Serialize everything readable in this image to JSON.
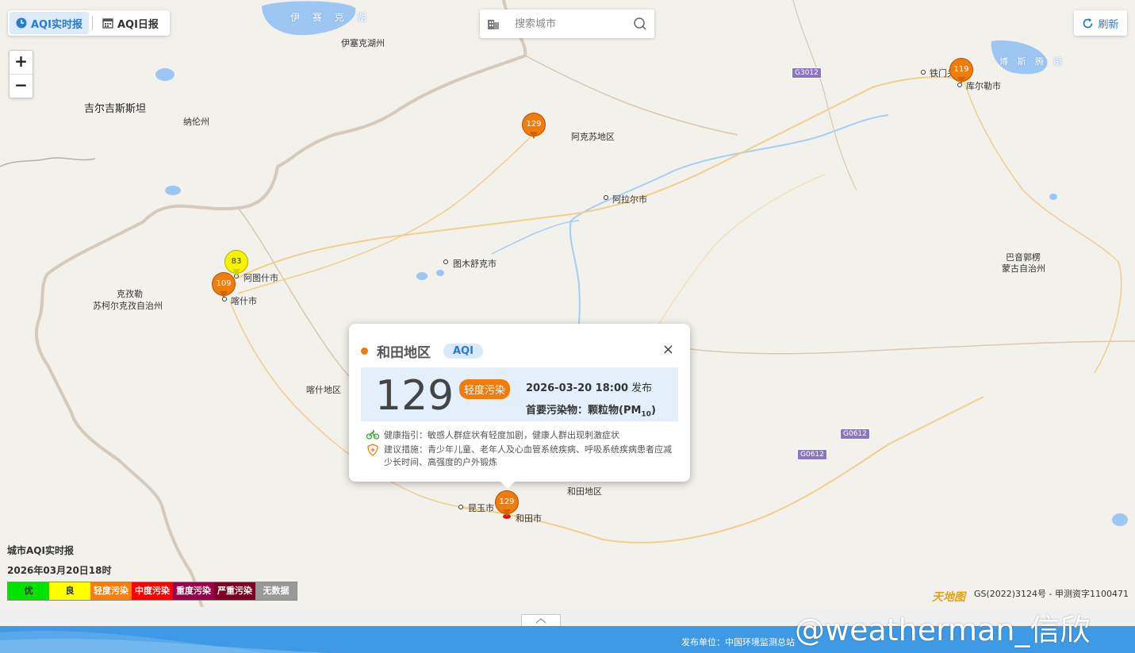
{
  "tabs": [
    {
      "label": "AQI实时报",
      "icon": "clock-icon",
      "active": true
    },
    {
      "label": "AQI日报",
      "icon": "calendar-icon",
      "active": false
    }
  ],
  "search": {
    "placeholder": "搜索城市",
    "icon": "magnifier-icon"
  },
  "refresh": {
    "label": "刷新",
    "icon": "refresh-icon"
  },
  "zoom": {
    "in": "+",
    "out": "−"
  },
  "map": {
    "labels": {
      "lake_yisaike": "伊 赛 克 湖",
      "yisaike_lake": "伊塞克湖州",
      "kyrgyzstan": "吉尔吉斯斯坦",
      "naryn": "纳伦州",
      "aksu_pref": "阿克苏地区",
      "aral": "阿拉尔市",
      "tumxuk": "图木舒克市",
      "artux": "阿图什市",
      "kashgar": "喀什市",
      "kizilsu_1": "克孜勒",
      "kizilsu_2": "苏柯尔克孜自治州",
      "kashgar_pref": "喀什地区",
      "korla": "库尔勒市",
      "tiemen": "铁门关",
      "bosten_lake": "博 斯 腾 湖",
      "bayingol_1": "巴音郭楞",
      "bayingol_2": "蒙古自治州",
      "hotan_pref": "和田地区",
      "hotan": "和田市",
      "kunyu": "昆玉市",
      "hw1": "G3012",
      "hw2": "G0612",
      "hw3": "G0612"
    },
    "markers": [
      {
        "city": "阿克苏地区",
        "aqi": "129",
        "color": "#f07c0c"
      },
      {
        "city": "库尔勒市",
        "aqi": "119",
        "color": "#f07c0c"
      },
      {
        "city": "阿图什市",
        "aqi": "83",
        "color": "#f7f200"
      },
      {
        "city": "喀什市",
        "aqi": "109",
        "color": "#f07c0c"
      },
      {
        "city": "和田市",
        "aqi": "129",
        "color": "#f07c0c"
      }
    ]
  },
  "popup": {
    "city": "和田地区",
    "tag": "AQI",
    "aqi": "129",
    "level": "轻度污染",
    "level_color": "#f07c0c",
    "time": "2026-03-20 18:00",
    "published": "发布",
    "pollutant_prefix": "首要污染物：颗粒物(PM",
    "pollutant_sub": "10",
    "pollutant_suffix": ")",
    "health": "健康指引：敏感人群症状有轻度加剧，健康人群出现刺激症状",
    "advice": "建议措施：青少年儿童、老年人及心血管系统疾病、呼吸系统疾病患者应减少长时间、高强度的户外锻炼",
    "close": "×"
  },
  "legend": {
    "title": "城市AQI实时报",
    "datetime": "2026年03月20日18时",
    "items": [
      {
        "label": "优",
        "color": "#00e400",
        "text_color": "#333333"
      },
      {
        "label": "良",
        "color": "#ffff00",
        "text_color": "#333333"
      },
      {
        "label": "轻度污染",
        "color": "#ff7e00",
        "text_color": "#ffffff"
      },
      {
        "label": "中度污染",
        "color": "#ff0000",
        "text_color": "#ffffff"
      },
      {
        "label": "重度污染",
        "color": "#99004c",
        "text_color": "#ffffff"
      },
      {
        "label": "严重污染",
        "color": "#7e0023",
        "text_color": "#ffffff"
      },
      {
        "label": "无数据",
        "color": "#999999",
        "text_color": "#ffffff"
      }
    ]
  },
  "map_credit": "GS(2022)3124号 - 甲测资字1100471",
  "map_logo": "天地图",
  "footer": {
    "publisher": "发布单位：中国环境监测总站"
  },
  "watermark": "@weatherman_信欣"
}
